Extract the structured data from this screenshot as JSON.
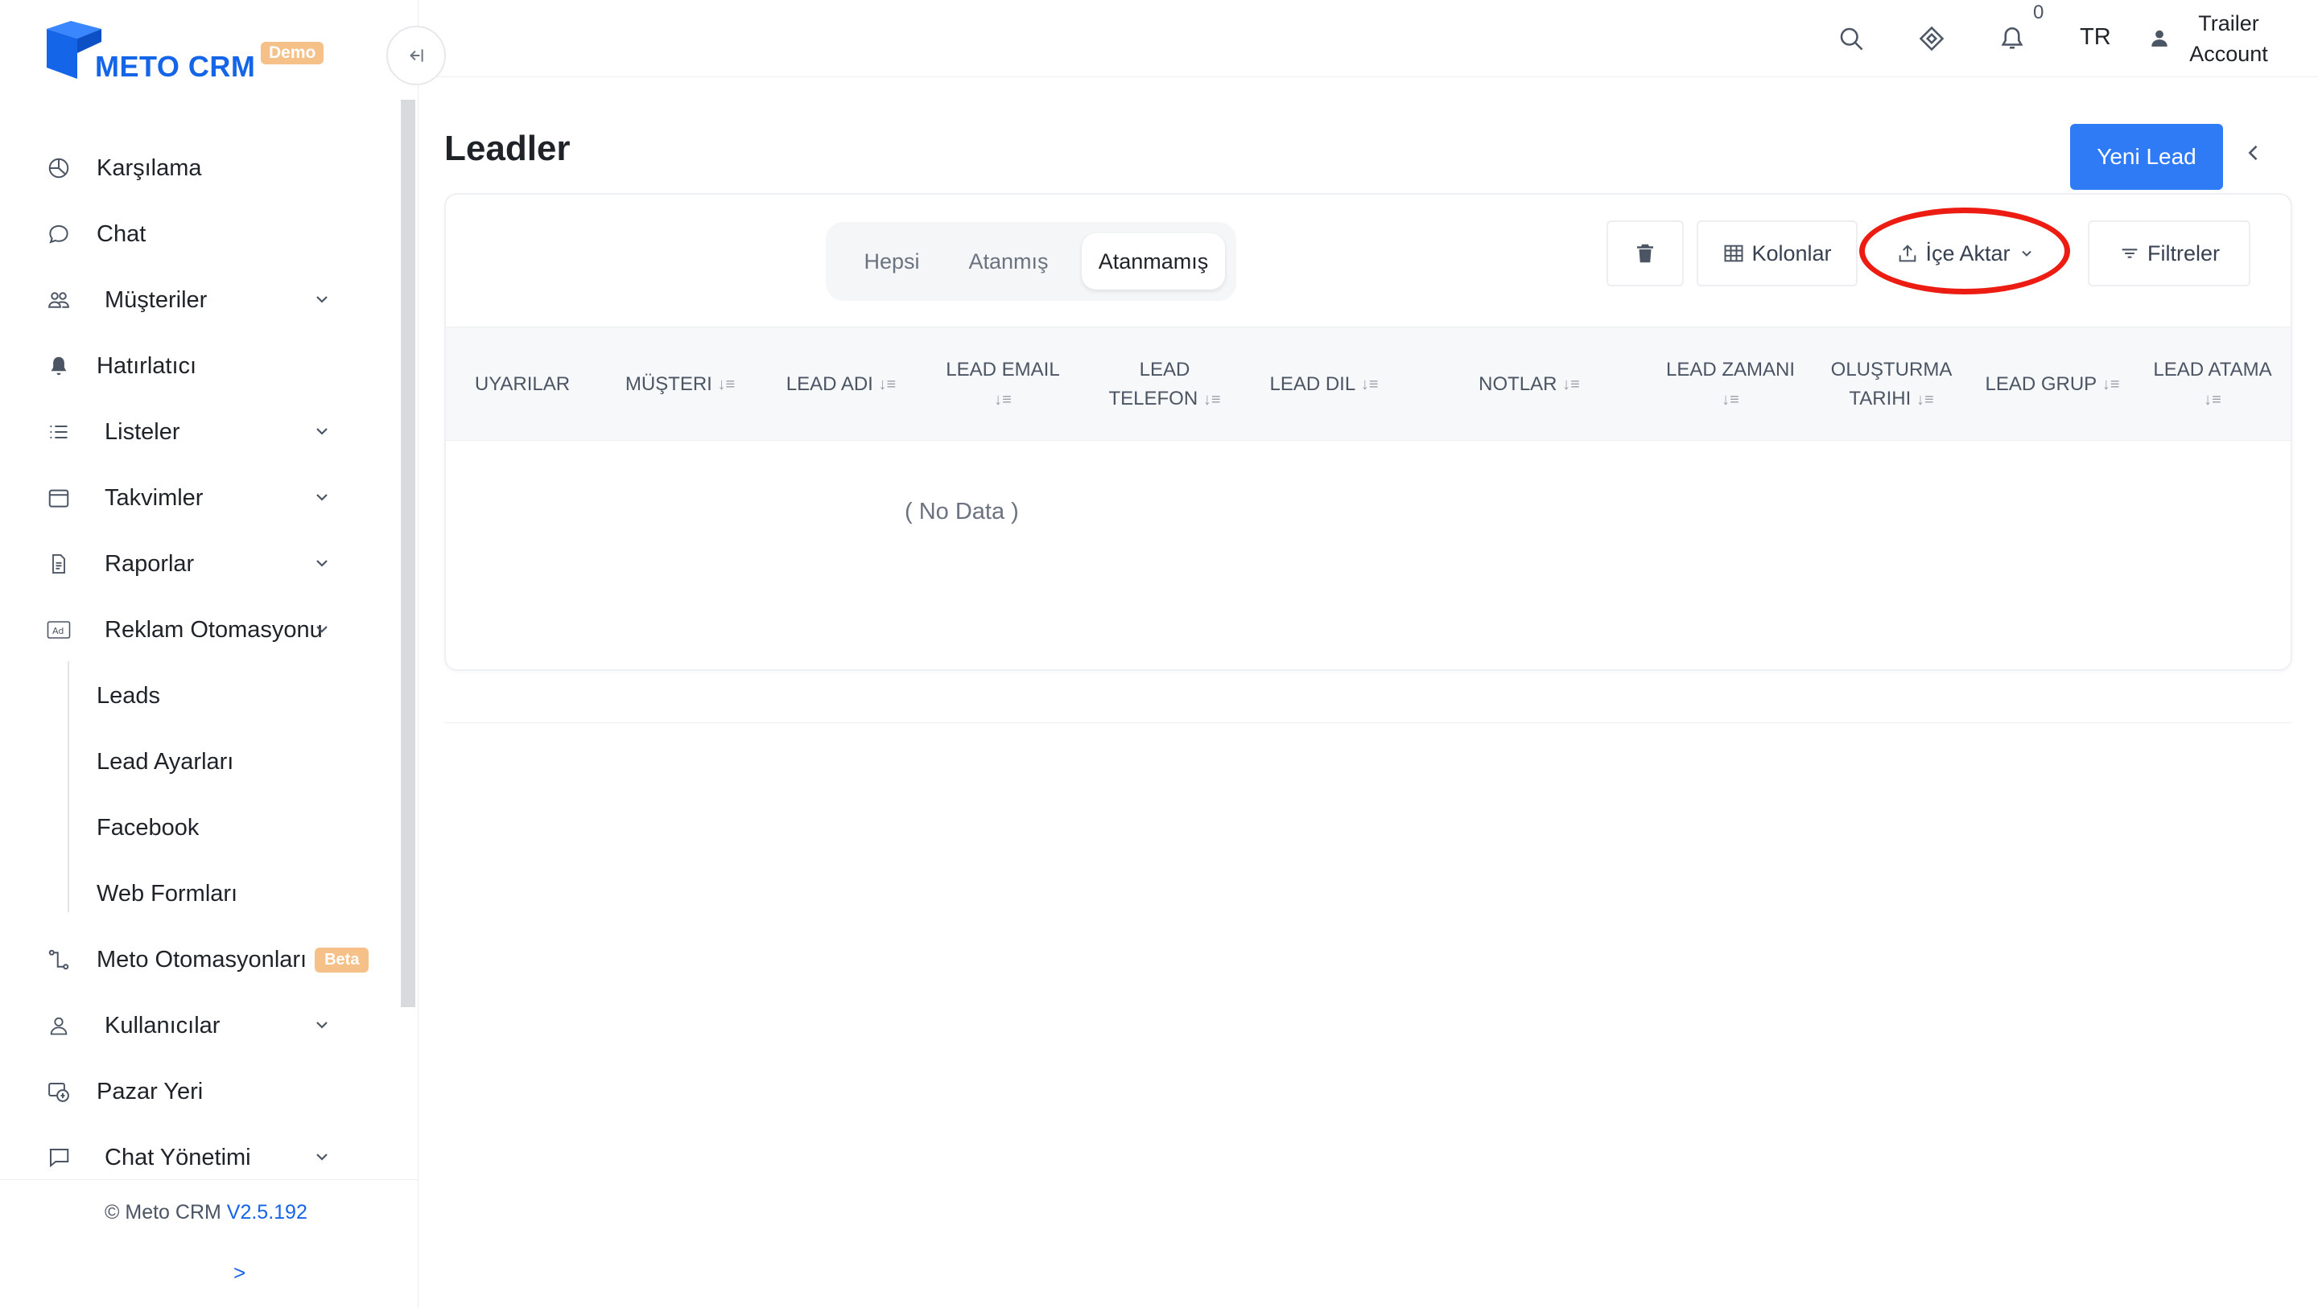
{
  "brand": {
    "name": "METO CRM",
    "badge": "Demo",
    "primary_color": "#1565e8",
    "badge_color": "#f6c089"
  },
  "sidebar": {
    "items": [
      {
        "label": "Karşılama",
        "icon": "dashboard-icon",
        "expandable": false
      },
      {
        "label": "Chat",
        "icon": "chat-bubble-icon",
        "expandable": false
      },
      {
        "label": "Müşteriler",
        "icon": "customers-icon",
        "expandable": true
      },
      {
        "label": "Hatırlatıcı",
        "icon": "bell-icon",
        "expandable": false
      },
      {
        "label": "Listeler",
        "icon": "list-icon",
        "expandable": true
      },
      {
        "label": "Takvimler",
        "icon": "calendar-icon",
        "expandable": true
      },
      {
        "label": "Raporlar",
        "icon": "report-icon",
        "expandable": true
      },
      {
        "label": "Reklam Otomasyonu",
        "icon": "ad-icon",
        "expandable": true,
        "expanded": true
      }
    ],
    "subitems": [
      "Leads",
      "Lead Ayarları",
      "Facebook",
      "Web Formları"
    ],
    "items_after": [
      {
        "label": "Meto Otomasyonları",
        "icon": "automation-icon",
        "badge": "Beta"
      },
      {
        "label": "Kullanıcılar",
        "icon": "user-icon",
        "expandable": true
      },
      {
        "label": "Pazar Yeri",
        "icon": "marketplace-icon",
        "expandable": false
      },
      {
        "label": "Chat Yönetimi",
        "icon": "chat-management-icon",
        "expandable": true
      }
    ],
    "footer": {
      "copyright": "© Meto CRM",
      "version": "V2.5.192",
      "expand": ">"
    }
  },
  "header": {
    "notification_count": "0",
    "language": "TR",
    "account_line1": "Trailer",
    "account_line2": "Account"
  },
  "page": {
    "title": "Leadler",
    "new_button": "Yeni Lead",
    "accent_color": "#2f7bf5",
    "tabs": [
      "Hepsi",
      "Atanmış",
      "Atanmamış"
    ],
    "active_tab": "Atanmamış",
    "toolbar": {
      "columns": "Kolonlar",
      "import": "İçe Aktar",
      "filters": "Filtreler"
    },
    "highlight_color": "#ec1c12",
    "columns": [
      {
        "line1": "UYARILAR",
        "line2": "",
        "sortable": false
      },
      {
        "line1": "MÜŞTERI",
        "line2": "",
        "sortable": true
      },
      {
        "line1": "LEAD ADI",
        "line2": "",
        "sortable": true
      },
      {
        "line1": "LEAD EMAIL",
        "line2": "",
        "sortable": true
      },
      {
        "line1": "LEAD",
        "line2": "TELEFON",
        "sortable": true
      },
      {
        "line1": "LEAD DIL",
        "line2": "",
        "sortable": true
      },
      {
        "line1": "NOTLAR",
        "line2": "",
        "sortable": true
      },
      {
        "line1": "LEAD ZAMANI",
        "line2": "",
        "sortable": true
      },
      {
        "line1": "OLUŞTURMA",
        "line2": "TARIHI",
        "sortable": true
      },
      {
        "line1": "LEAD GRUP",
        "line2": "",
        "sortable": true
      },
      {
        "line1": "LEAD ATAMA",
        "line2": "",
        "sortable": true
      }
    ],
    "empty_text": "( No Data )",
    "sort_glyph": "↓≡"
  }
}
